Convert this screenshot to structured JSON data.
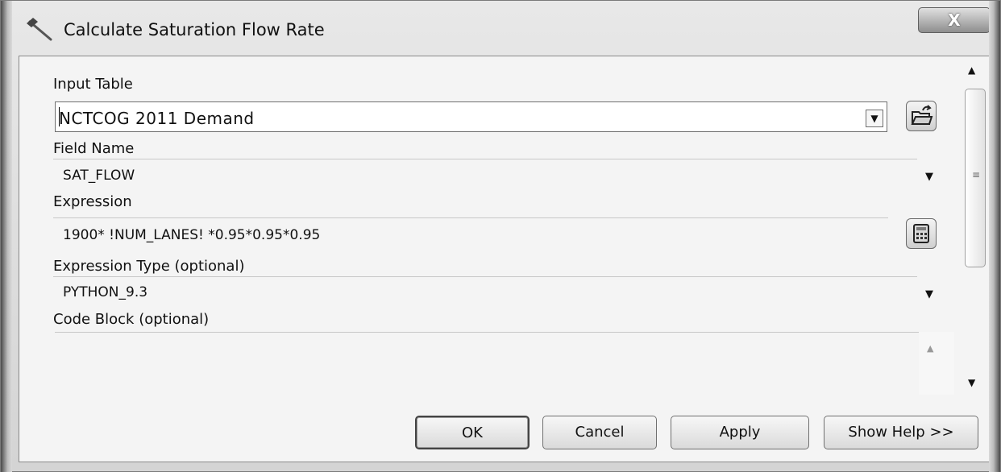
{
  "window": {
    "title": "Calculate Saturation Flow Rate",
    "close_label": "X"
  },
  "fields": {
    "input_table": {
      "label": "Input Table",
      "value": "NCTCOG 2011 Demand"
    },
    "field_name": {
      "label": "Field Name",
      "value": "SAT_FLOW"
    },
    "expression": {
      "label": "Expression",
      "value": "1900* !NUM_LANES! *0.95*0.95*0.95"
    },
    "expression_type": {
      "label": "Expression Type (optional)",
      "value": "PYTHON_9.3"
    },
    "code_block": {
      "label": "Code Block (optional)",
      "value": ""
    }
  },
  "buttons": {
    "ok": "OK",
    "cancel": "Cancel",
    "apply": "Apply",
    "show_help": "Show Help >>"
  },
  "icons": {
    "title": "hammer-icon",
    "browse": "open-folder-icon",
    "calculator": "calculator-icon"
  }
}
